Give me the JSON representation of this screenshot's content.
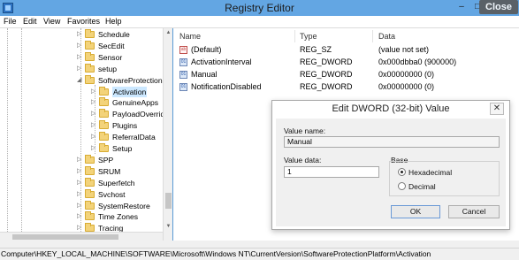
{
  "window": {
    "title": "Registry Editor",
    "min_glyph": "–",
    "max_glyph": "□",
    "close_glyph": "✕",
    "close_badge": "Close"
  },
  "menu": [
    "File",
    "Edit",
    "View",
    "Favorites",
    "Help"
  ],
  "tree": [
    {
      "label": "Schedule",
      "level": 0
    },
    {
      "label": "SecEdit",
      "level": 0
    },
    {
      "label": "Sensor",
      "level": 0
    },
    {
      "label": "setup",
      "level": 0
    },
    {
      "label": "SoftwareProtectionPlatform",
      "level": 0,
      "expanded": true
    },
    {
      "label": "Activation",
      "level": 1,
      "selected": true
    },
    {
      "label": "GenuineApps",
      "level": 1
    },
    {
      "label": "PayloadOverride",
      "level": 1
    },
    {
      "label": "Plugins",
      "level": 1
    },
    {
      "label": "ReferralData",
      "level": 1
    },
    {
      "label": "Setup",
      "level": 1
    },
    {
      "label": "SPP",
      "level": 0
    },
    {
      "label": "SRUM",
      "level": 0
    },
    {
      "label": "Superfetch",
      "level": 0
    },
    {
      "label": "Svchost",
      "level": 0
    },
    {
      "label": "SystemRestore",
      "level": 0
    },
    {
      "label": "Time Zones",
      "level": 0
    },
    {
      "label": "Tracing",
      "level": 0
    }
  ],
  "values_pane": {
    "headers": {
      "name": "Name",
      "type": "Type",
      "data": "Data"
    },
    "rows": [
      {
        "icon": "ab",
        "name": "(Default)",
        "type": "REG_SZ",
        "data": "(value not set)"
      },
      {
        "icon": "01",
        "name": "ActivationInterval",
        "type": "REG_DWORD",
        "data": "0x000dbba0 (900000)"
      },
      {
        "icon": "01",
        "name": "Manual",
        "type": "REG_DWORD",
        "data": "0x00000000 (0)"
      },
      {
        "icon": "01",
        "name": "NotificationDisabled",
        "type": "REG_DWORD",
        "data": "0x00000000 (0)"
      }
    ]
  },
  "dialog": {
    "title": "Edit DWORD (32-bit) Value",
    "close_glyph": "✕",
    "value_name_label": "Value name:",
    "value_name": "Manual",
    "value_data_label": "Value data:",
    "value_data": "1",
    "base_label": "Base",
    "hex_label": "Hexadecimal",
    "dec_label": "Decimal",
    "ok": "OK",
    "cancel": "Cancel"
  },
  "status": "Computer\\HKEY_LOCAL_MACHINE\\SOFTWARE\\Microsoft\\Windows NT\\CurrentVersion\\SoftwareProtectionPlatform\\Activation"
}
